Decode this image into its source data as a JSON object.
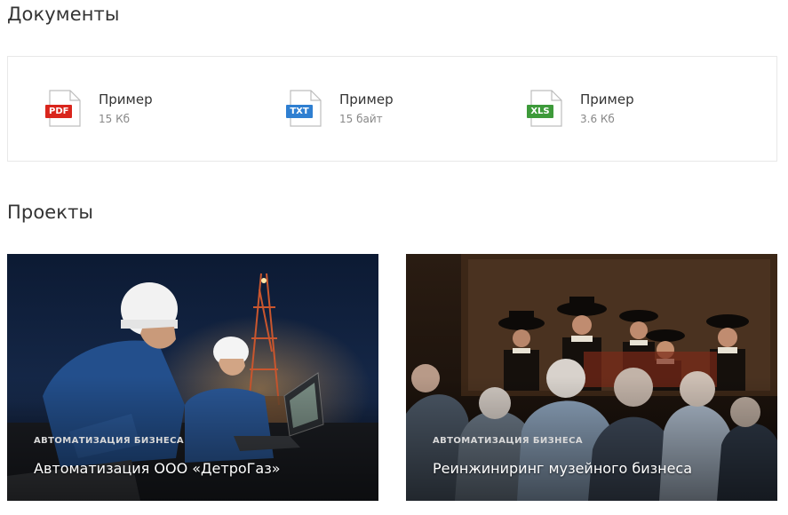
{
  "documents": {
    "title": "Документы",
    "items": [
      {
        "name": "Пример",
        "size": "15 Кб",
        "type": "PDF",
        "color": "#d9251c"
      },
      {
        "name": "Пример",
        "size": "15 байт",
        "type": "TXT",
        "color": "#2f7fd1"
      },
      {
        "name": "Пример",
        "size": "3.6 Кб",
        "type": "XLS",
        "color": "#3d9a3a"
      }
    ]
  },
  "projects": {
    "title": "Проекты",
    "items": [
      {
        "tag": "АВТОМАТИЗАЦИЯ БИЗНЕСА",
        "title": "Автоматизация ООО «ДетроГаз»",
        "image": "oil-rig-workers-night-photo"
      },
      {
        "tag": "АВТОМАТИЗАЦИЯ БИЗНЕСА",
        "title": "Реинжиниринг музейного бизнеса",
        "image": "museum-visitors-painting-photo"
      }
    ]
  }
}
